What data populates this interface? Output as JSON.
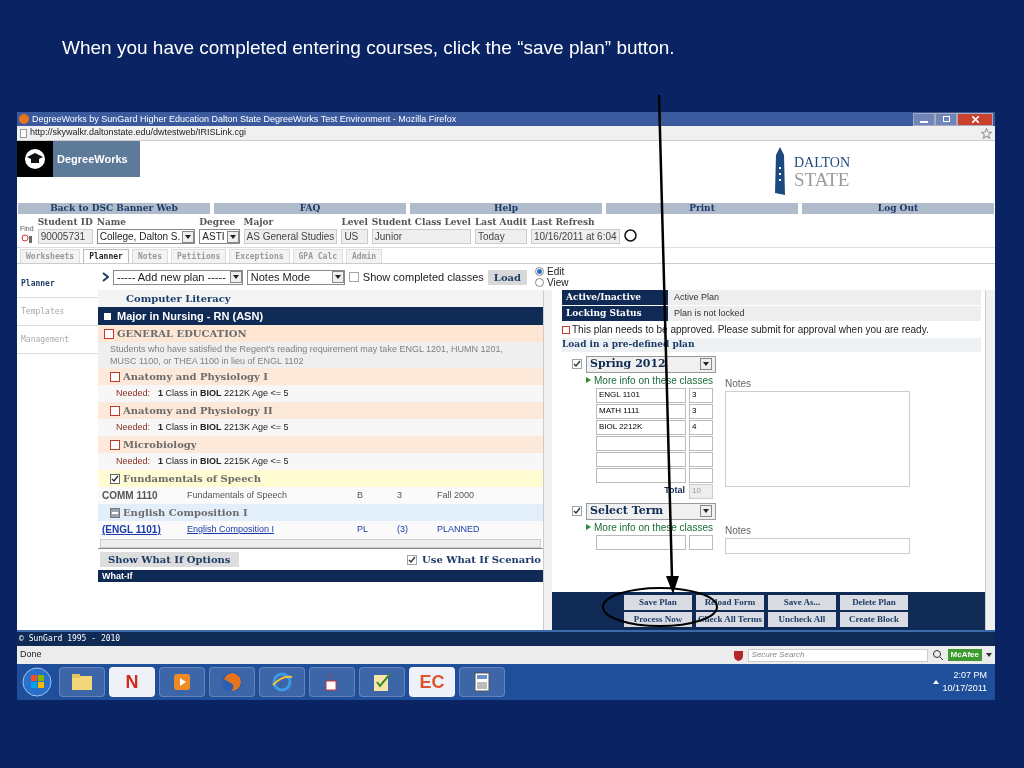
{
  "slide_title": "When you have completed entering courses, click the “save plan” button.",
  "browser": {
    "title": "DegreeWorks by SunGard Higher Education Dalton State DegreeWorks Test Environment - Mozilla Firefox",
    "url": "http://skywalkr.daltonstate.edu/dwtestweb/IRISLink.cgi",
    "status": "Done",
    "search_placeholder": "Secure Search",
    "security_badge": "McAfee"
  },
  "header": {
    "app_name": "DegreeWorks",
    "school_line_1": "DALTON",
    "school_line_2": "STATE"
  },
  "nav_links": [
    "Back to DSC Banner Web",
    "FAQ",
    "Help",
    "Print",
    "Log Out"
  ],
  "student": {
    "find_label": "Find",
    "fields": [
      {
        "label": "Student ID",
        "value": "90005731",
        "kind": "text"
      },
      {
        "label": "Name",
        "value": "College, Dalton S.",
        "kind": "select"
      },
      {
        "label": "Degree",
        "value": "ASTI",
        "kind": "select"
      },
      {
        "label": "Major",
        "value": "AS General Studies",
        "kind": "text"
      },
      {
        "label": "Level",
        "value": "US",
        "kind": "text"
      },
      {
        "label": "Student Class Level",
        "value": "Junior",
        "kind": "text"
      },
      {
        "label": "Last Audit",
        "value": "Today",
        "kind": "text"
      },
      {
        "label": "Last Refresh",
        "value": "10/16/2011 at 6:04",
        "kind": "text"
      }
    ]
  },
  "tabs": [
    {
      "label": "Worksheets",
      "selected": false
    },
    {
      "label": "Planner",
      "selected": true
    },
    {
      "label": "Notes",
      "selected": false
    },
    {
      "label": "Petitions",
      "selected": false
    },
    {
      "label": "Exceptions",
      "selected": false
    },
    {
      "label": "GPA Calc",
      "selected": false
    },
    {
      "label": "Admin",
      "selected": false
    }
  ],
  "sidebar": [
    {
      "label": "Planner",
      "selected": true
    },
    {
      "label": "Templates",
      "selected": false
    },
    {
      "label": "Management",
      "selected": false
    }
  ],
  "toolbar": {
    "plan_select": "----- Add new plan -----",
    "mode_select": "Notes Mode",
    "show_completed": {
      "label": "Show completed classes",
      "checked": false
    },
    "load_button": "Load",
    "modes": [
      {
        "label": "Edit",
        "selected": true
      },
      {
        "label": "View",
        "selected": false
      }
    ]
  },
  "audit": [
    {
      "kind": "heading",
      "text": "Computer Literacy"
    },
    {
      "kind": "block",
      "text": "Major in Nursing - RN (ASN)"
    },
    {
      "kind": "section",
      "text": "GENERAL EDUCATION",
      "checked": false
    },
    {
      "kind": "note",
      "text": "Students who have satisfied the Regent's reading requirement may take ENGL 1201, HUMN 1201, MUSC 1100, or THEA 1100 in lieu of ENGL 1102"
    },
    {
      "kind": "requirement",
      "text": "Anatomy and Physiology I",
      "checked": false,
      "in_progress": false
    },
    {
      "kind": "needed",
      "label": "Needed:",
      "text": "**1** Class in **BIOL** 2212K Age <= 5"
    },
    {
      "kind": "requirement",
      "text": "Anatomy and Physiology II",
      "checked": false,
      "in_progress": false
    },
    {
      "kind": "needed",
      "label": "Needed:",
      "text": "**1** Class in **BIOL** 2213K Age <= 5"
    },
    {
      "kind": "requirement",
      "text": "Microbiology",
      "checked": false,
      "in_progress": false
    },
    {
      "kind": "needed",
      "label": "Needed:",
      "text": "**1** Class in **BIOL** 2215K Age <= 5"
    },
    {
      "kind": "requirement",
      "text": "Fundamentals of Speech",
      "checked": true,
      "in_progress": false
    },
    {
      "kind": "course",
      "code": "COMM 1110",
      "title": "Fundamentals of Speech",
      "grade": "B",
      "credits": "3",
      "term": "Fall 2000",
      "planned": false
    },
    {
      "kind": "requirement",
      "text": "English Composition I",
      "in_progress": true
    },
    {
      "kind": "course",
      "code": "(ENGL 1101)",
      "title": "English Composition I",
      "grade": "PL",
      "credits": "(3)",
      "term": "PLANNED",
      "planned": true
    }
  ],
  "what_if": {
    "button": "Show What If Options",
    "scenario": {
      "label": "Use What If Scenario",
      "checked": true
    },
    "header": "What-If"
  },
  "plan": {
    "status_rows": [
      {
        "label": "Active/Inactive",
        "value": "Active Plan"
      },
      {
        "label": "Locking Status",
        "value": "Plan is not locked"
      }
    ],
    "warning": "This plan needs to be approved. Please submit for approval when you are ready.",
    "preset_link": "Load in a pre-defined plan",
    "terms": [
      {
        "checked": true,
        "term": "Spring 2012",
        "more": "More info on these classes",
        "notes_label": "Notes",
        "courses": [
          {
            "kind": "entry",
            "course": "ENGL 1101",
            "credits": "3"
          },
          {
            "kind": "entry",
            "course": "MATH 1111",
            "credits": "3"
          },
          {
            "kind": "entry",
            "course": "BIOL 2212K",
            "credits": "4"
          },
          {
            "kind": "blank"
          },
          {
            "kind": "blank"
          },
          {
            "kind": "blank"
          }
        ],
        "total_label": "Total",
        "total": "10"
      },
      {
        "checked": true,
        "term": "Select Term",
        "more": "More info on these classes",
        "notes_label": "Notes",
        "courses": [
          {
            "kind": "blank"
          }
        ]
      }
    ],
    "buttons": [
      [
        "Save Plan",
        "Reload Form",
        "Save As...",
        "Delete Plan"
      ],
      [
        "Process Now",
        "Check All Terms",
        "Uncheck All",
        "Create Block"
      ]
    ]
  },
  "footer": "© SunGard 1995 - 2010",
  "taskbar": {
    "items": [
      {
        "kind": "start"
      },
      {
        "kind": "folder"
      },
      {
        "kind": "glyph",
        "glyph": "N",
        "color": "#d42a1e"
      },
      {
        "kind": "media"
      },
      {
        "kind": "firefox"
      },
      {
        "kind": "browser"
      },
      {
        "kind": "java"
      },
      {
        "kind": "tasks"
      },
      {
        "kind": "glyph",
        "glyph": "EC",
        "color": "#e0542c"
      },
      {
        "kind": "calculator"
      }
    ],
    "time": "2:07 PM",
    "date": "10/17/2011"
  }
}
